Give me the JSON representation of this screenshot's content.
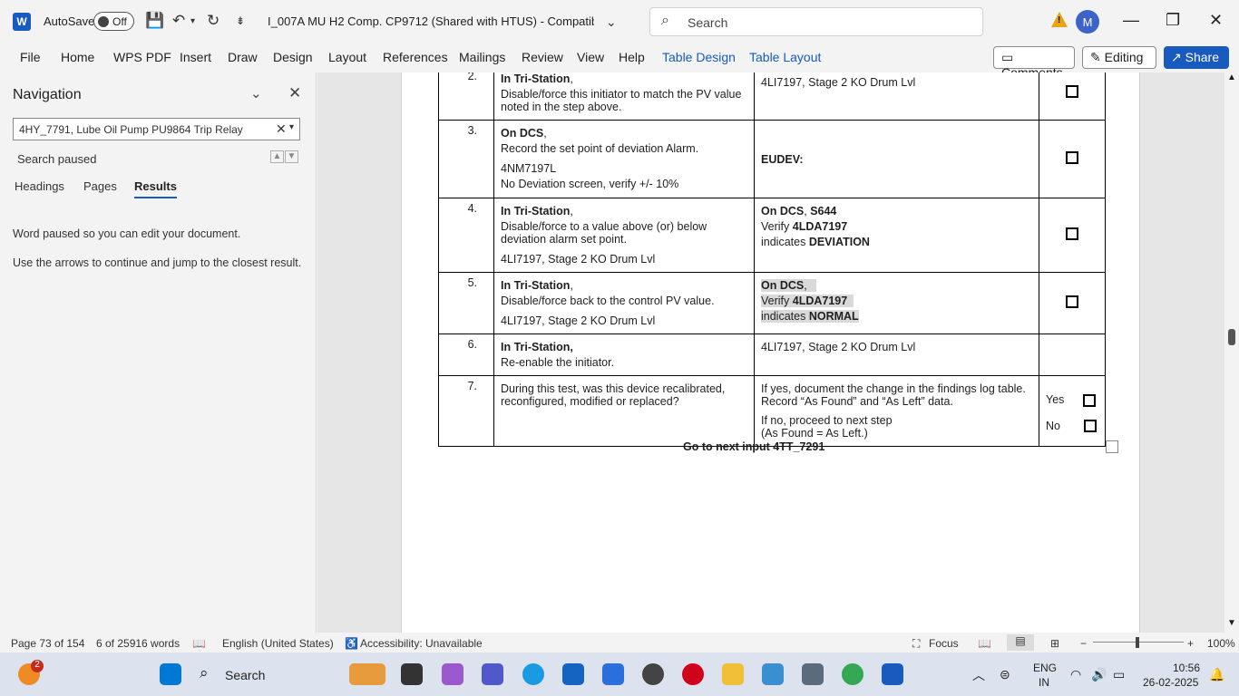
{
  "titlebar": {
    "app_logo": "W",
    "autosave_label": "AutoSave",
    "autosave_state": "Off",
    "doc_title": "I_007A MU H2 Comp. CP9712 (Shared with HTUS)  -  Compatibility...",
    "search_placeholder": "Search",
    "avatar_initial": "M"
  },
  "ribbon": {
    "tabs": [
      "File",
      "Home",
      "WPS PDF",
      "Insert",
      "Draw",
      "Design",
      "Layout",
      "References",
      "Mailings",
      "Review",
      "View",
      "Help",
      "Table Design",
      "Table Layout"
    ],
    "comments_label": "Comments",
    "editing_label": "Editing",
    "share_label": "Share"
  },
  "navigation": {
    "title": "Navigation",
    "search_value": "4HY_7791, Lube Oil Pump PU9864 Trip Relay",
    "status": "Search paused",
    "tabs": [
      "Headings",
      "Pages",
      "Results"
    ],
    "message_1": "Word paused so you can edit your document.",
    "message_2": "Use the arrows to continue and jump to the closest result."
  },
  "table": {
    "rows": [
      {
        "num": "2.",
        "a1": "In Tri-Station",
        "a1s": ",",
        "a2": "Disable/force this initiator to match the PV value noted in the step above.",
        "r1": "4LI7197, Stage 2 KO Drum Lvl"
      },
      {
        "num": "3.",
        "a1": "On DCS",
        "a1s": ",",
        "a2": "Record the set point of deviation Alarm.",
        "a3": "4NM7197L",
        "a4": "No Deviation screen, verify +/- 10%",
        "r1": "EUDEV:"
      },
      {
        "num": "4.",
        "a1": "In Tri-Station",
        "a1s": ",",
        "a2": "Disable/force to a value above (or) below deviation alarm set point.",
        "a3": "4LI7197, Stage 2 KO Drum Lvl",
        "r1a": "On DCS",
        "r1b": ", ",
        "r1c": "S644",
        "r2a": "Verify ",
        "r2b": "4LDA7197",
        "r3a": " indicates ",
        "r3b": "DEVIATION"
      },
      {
        "num": "5.",
        "a1": "In Tri-Station",
        "a1s": ",",
        "a2": "Disable/force back to the control PV value.",
        "a3": "4LI7197, Stage 2 KO Drum Lvl",
        "r1a": "On DCS",
        "r1b": ",",
        "r2a": "Verify ",
        "r2b": "4LDA7197",
        "r3a": " indicates ",
        "r3b": "NORMAL"
      },
      {
        "num": "6.",
        "a1": "In Tri-Station,",
        "a2": "Re-enable the initiator.",
        "r1": "4LI7197, Stage 2 KO Drum Lvl"
      },
      {
        "num": "7.",
        "a2": "During this test, was this device recalibrated, reconfigured, modified or replaced?",
        "r1": "If yes, document the change in the findings log table. Record “As Found” and “As Left” data.",
        "r2": "If no, proceed to next step",
        "r3": "(As Found = As Left.)",
        "yes": "Yes",
        "no": "No"
      }
    ],
    "next_label": "Go to next input 4TT_7291"
  },
  "statusbar": {
    "page": "Page 73 of 154",
    "words": "6 of 25916 words",
    "language": "English (United States)",
    "accessibility": "Accessibility: Unavailable",
    "focus": "Focus",
    "zoom": "100%"
  },
  "taskbar": {
    "search_label": "Search",
    "badge": "2",
    "lang_1": "ENG",
    "lang_2": "IN",
    "time": "10:56",
    "date": "26-02-2025"
  }
}
